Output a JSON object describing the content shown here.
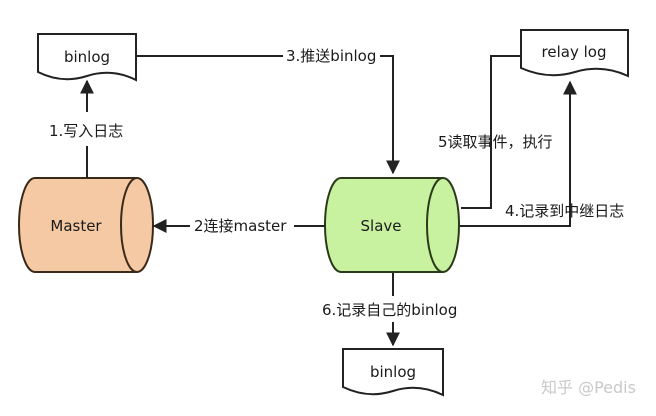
{
  "nodes": {
    "binlog_top": "binlog",
    "relay_log": "relay log",
    "master": "Master",
    "slave": "Slave",
    "binlog_bottom": "binlog"
  },
  "edges": {
    "write_log": "1.写入日志",
    "connect_master": "2连接master",
    "push_binlog": "3.推送binlog",
    "record_relay": "4.记录到中继日志",
    "read_execute": "5读取事件，执行",
    "record_own_binlog": "6.记录自己的binlog"
  },
  "watermark": "知乎 @Pedis",
  "colors": {
    "master_fill": "#f5c9a3",
    "master_stroke": "#3a2a1a",
    "slave_fill": "#c9f2a0",
    "slave_stroke": "#2a3a1a",
    "line": "#222222"
  }
}
